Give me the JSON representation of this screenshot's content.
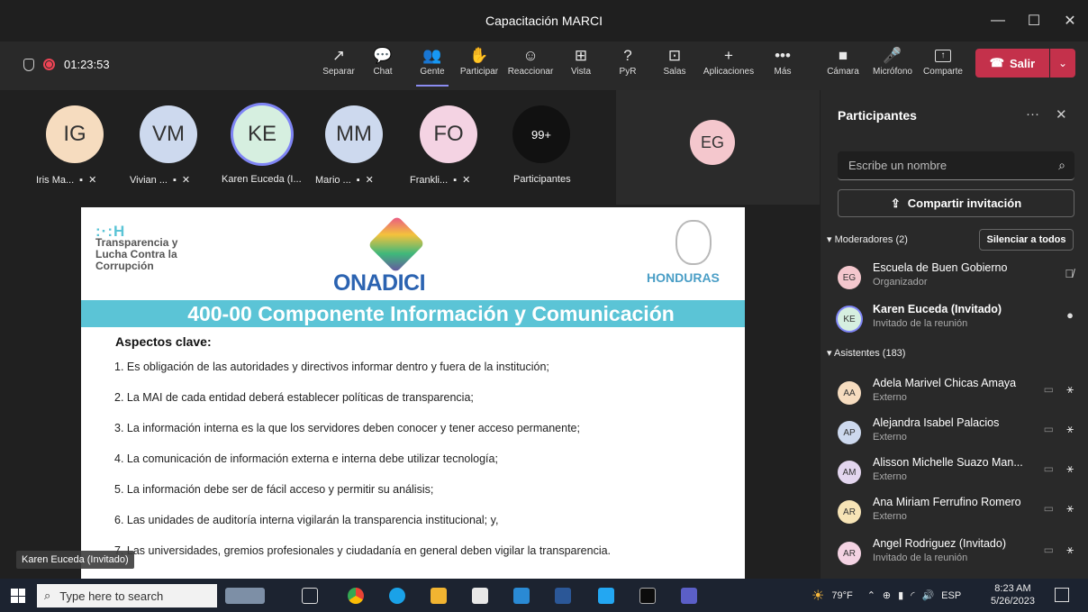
{
  "window": {
    "title": "Capacitación MARCI",
    "minimize": "—",
    "maximize": "☐",
    "close": "✕"
  },
  "toolbar": {
    "timer": "01:23:53",
    "buttons": [
      {
        "label": "Separar",
        "icon": "↗"
      },
      {
        "label": "Chat",
        "icon": "💬"
      },
      {
        "label": "Gente",
        "icon": "👥"
      },
      {
        "label": "Participar",
        "icon": "✋"
      },
      {
        "label": "Reaccionar",
        "icon": "☺"
      },
      {
        "label": "Vista",
        "icon": "⊞"
      },
      {
        "label": "PyR",
        "icon": "?"
      },
      {
        "label": "Salas",
        "icon": "⊡"
      },
      {
        "label": "Aplicaciones",
        "icon": "+"
      },
      {
        "label": "Más",
        "icon": "•••"
      },
      {
        "label": "Cámara",
        "icon": "■"
      },
      {
        "label": "Micrófono",
        "icon": "🎤"
      },
      {
        "label": "Comparte",
        "icon": "↑"
      }
    ],
    "leave_label": "Salir",
    "accent": "#c4314b"
  },
  "gallery": [
    {
      "initials": "IG",
      "name": "Iris Ma...",
      "color": "#f6dcbf"
    },
    {
      "initials": "VM",
      "name": "Vivian ...",
      "color": "#cdd9ee"
    },
    {
      "initials": "KE",
      "name": "Karen Euceda (I...",
      "color": "#d6efe0"
    },
    {
      "initials": "MM",
      "name": "Mario ...",
      "color": "#cdd9ee"
    },
    {
      "initials": "FO",
      "name": "Frankli...",
      "color": "#f4d3e3"
    },
    {
      "initials": "99+",
      "name": "Participantes",
      "color": "#111111"
    }
  ],
  "spotlight": {
    "initials": "EG",
    "color": "#f4c7cd"
  },
  "slide": {
    "logo_mark": ":·:H",
    "logo_lines": [
      "Transparencia y",
      "Lucha Contra la",
      "Corrupción"
    ],
    "center_logo": "ONADICI",
    "right_logo": "HONDURAS",
    "title": "400-00 Componente Información y Comunicación",
    "subtitle": "Aspectos clave:",
    "items": [
      "1. Es obligación de las autoridades y directivos informar dentro y fuera de la institución;",
      "2. La MAI de cada entidad deberá establecer políticas de transparencia;",
      "3. La información interna es la que los servidores deben conocer y tener acceso permanente;",
      "4. La comunicación de información externa e interna debe utilizar tecnología;",
      "5. La información debe ser de fácil acceso y permitir su análisis;",
      "6. Las unidades de auditoría interna vigilarán la transparencia institucional; y,",
      "7. Las universidades, gremios profesionales y ciudadanía en general deben vigilar la transparencia."
    ]
  },
  "speaker_tag": "Karen Euceda (Invitado)",
  "panel": {
    "title": "Participantes",
    "search_placeholder": "Escribe un nombre",
    "share_label": "Compartir invitación",
    "moderators_label": "Moderadores (2)",
    "mute_all_label": "Silenciar a todos",
    "attendees_label": "Asistentes (183)",
    "moderators": [
      {
        "initials": "EG",
        "name": "Escuela de Buen Gobierno",
        "role": "Organizador",
        "color": "#f4c7cd",
        "mic": "muted"
      },
      {
        "initials": "KE",
        "name": "Karen Euceda (Invitado)",
        "role": "Invitado de la reunión",
        "color": "#d6efe0",
        "mic": "on"
      }
    ],
    "attendees": [
      {
        "initials": "AA",
        "name": "Adela Marivel Chicas Amaya",
        "role": "Externo",
        "color": "#f6dcbf"
      },
      {
        "initials": "AP",
        "name": "Alejandra Isabel Palacios",
        "role": "Externo",
        "color": "#cdd9ee"
      },
      {
        "initials": "AM",
        "name": "Alisson Michelle Suazo Man...",
        "role": "Externo",
        "color": "#e3d6ef"
      },
      {
        "initials": "AR",
        "name": "Ana Miriam Ferrufino Romero",
        "role": "Externo",
        "color": "#f7e4b6"
      },
      {
        "initials": "AR",
        "name": "Angel Rodriguez (Invitado)",
        "role": "Invitado de la reunión",
        "color": "#f4d3e3"
      }
    ]
  },
  "taskbar": {
    "search_placeholder": "Type here to search",
    "weather": "79°F",
    "lang": "ESP",
    "time": "8:23 AM",
    "date": "5/26/2023"
  }
}
